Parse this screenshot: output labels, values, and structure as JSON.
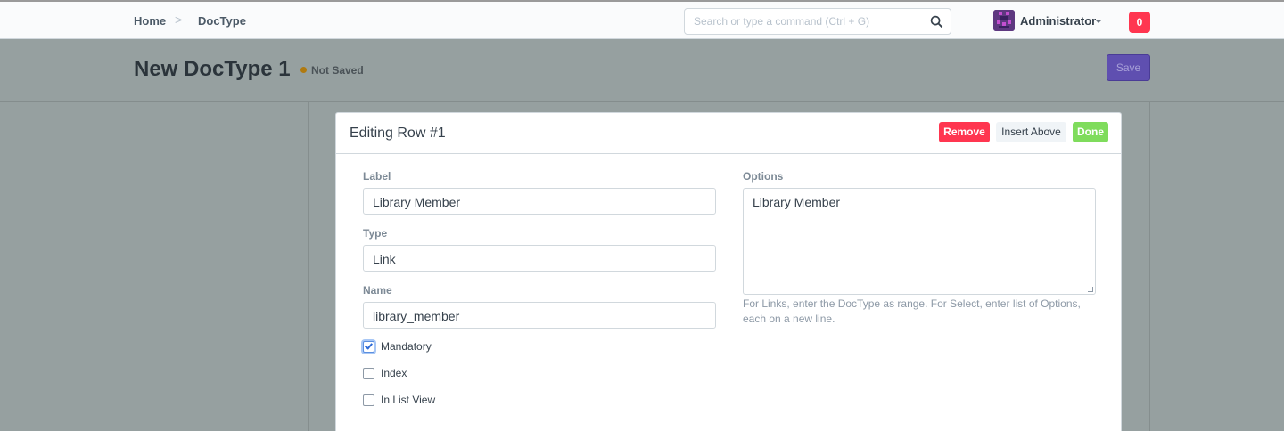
{
  "navbar": {
    "breadcrumbs": [
      "Home",
      "DocType"
    ],
    "separator": ">",
    "search_placeholder": "Search or type a command (Ctrl + G)",
    "user_name": "Administrator",
    "notification_count": "0"
  },
  "page": {
    "title": "New DocType 1",
    "status": "Not Saved",
    "save_label": "Save"
  },
  "modal": {
    "title": "Editing Row #1",
    "remove_label": "Remove",
    "insert_above_label": "Insert Above",
    "done_label": "Done",
    "fields": {
      "label": {
        "label": "Label",
        "value": "Library Member"
      },
      "type": {
        "label": "Type",
        "value": "Link"
      },
      "name": {
        "label": "Name",
        "value": "library_member"
      },
      "options": {
        "label": "Options",
        "value": "Library Member",
        "help": "For Links, enter the DocType as range. For Select, enter list of Options, each on a new line."
      }
    },
    "checkboxes": [
      {
        "label": "Mandatory",
        "checked": true
      },
      {
        "label": "Index",
        "checked": false
      },
      {
        "label": "In List View",
        "checked": false
      }
    ]
  },
  "colors": {
    "primary": "#5e64ff",
    "danger": "#ff3650",
    "success": "#7fdc5c",
    "status_dot": "#b07a10"
  }
}
